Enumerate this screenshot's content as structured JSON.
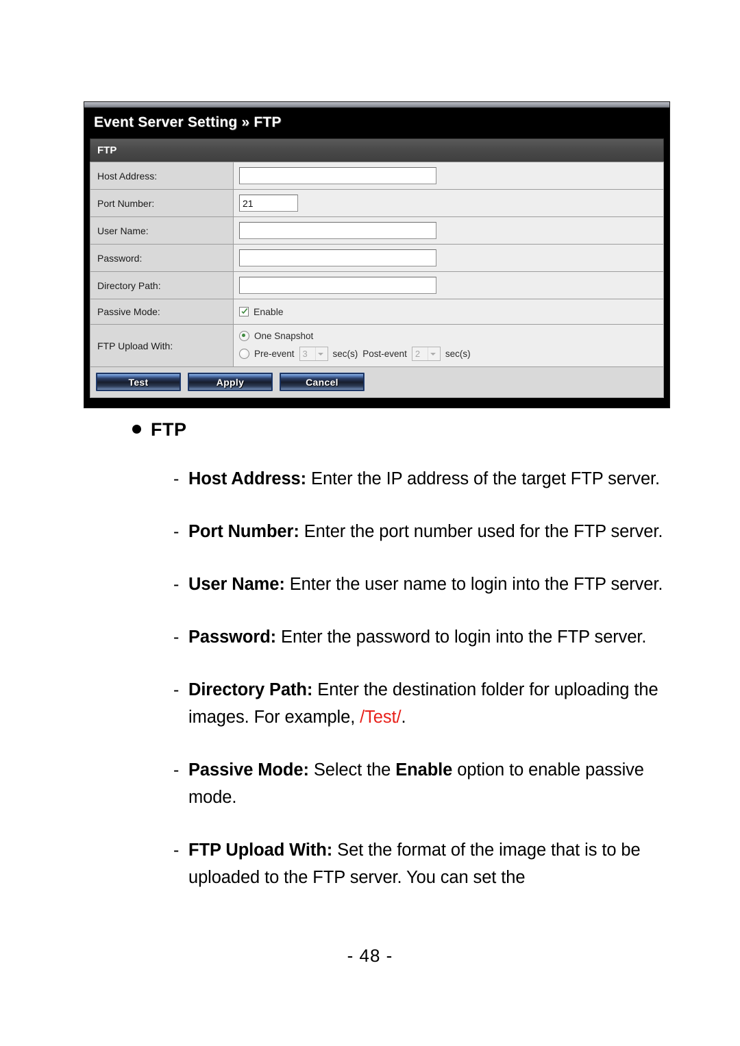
{
  "panel": {
    "title": "Event Server Setting » FTP",
    "section_header": "FTP",
    "rows": [
      {
        "label": "Host Address:",
        "type": "text",
        "value": ""
      },
      {
        "label": "Port Number:",
        "type": "text_narrow",
        "value": "21"
      },
      {
        "label": "User Name:",
        "type": "text",
        "value": ""
      },
      {
        "label": "Password:",
        "type": "text",
        "value": ""
      },
      {
        "label": "Directory Path:",
        "type": "text",
        "value": ""
      },
      {
        "label": "Passive Mode:",
        "type": "checkbox",
        "checkbox_label": "Enable",
        "checked": true
      },
      {
        "label": "FTP Upload With:",
        "type": "radio_group"
      }
    ],
    "upload_with": {
      "option_one_label": "One Snapshot",
      "option_one_selected": true,
      "option_two_selected": false,
      "pre_event_label": "Pre-event",
      "pre_event_value": "3",
      "pre_event_unit": "sec(s)",
      "post_event_label": "Post-event",
      "post_event_value": "2",
      "post_event_unit": "sec(s)"
    },
    "buttons": {
      "test": "Test",
      "apply": "Apply",
      "cancel": "Cancel"
    },
    "colors": {
      "title_bar": "#000000",
      "section_header": "#4a4a4a",
      "label_cell": "#d9d9d9",
      "value_cell": "#eeeeee",
      "button": "#20407a",
      "check_green": "#3f8a3f"
    }
  },
  "doc": {
    "heading": "FTP",
    "items": [
      {
        "term": "Host Address:",
        "text": " Enter the IP address of the target FTP server."
      },
      {
        "term": "Port Number:",
        "text": " Enter the port number used for the FTP server."
      },
      {
        "term": "User Name:",
        "text": " Enter the user name to login into the FTP server."
      },
      {
        "term": "Password:",
        "text": " Enter the password to login into the FTP server."
      },
      {
        "term": "Directory Path:",
        "text_before": " Enter the destination folder for uploading the images. For example, ",
        "highlight": "/Test/",
        "text_after": "."
      },
      {
        "term": "Passive Mode:",
        "text_before": " Select the ",
        "emphasis": "Enable",
        "text_after": " option to enable passive mode."
      },
      {
        "term": "FTP Upload With:",
        "text": " Set the format of the image that is to be uploaded to the FTP server. You can set the"
      }
    ],
    "page_number": "- 48 -",
    "highlight_color": "#e8201a"
  }
}
